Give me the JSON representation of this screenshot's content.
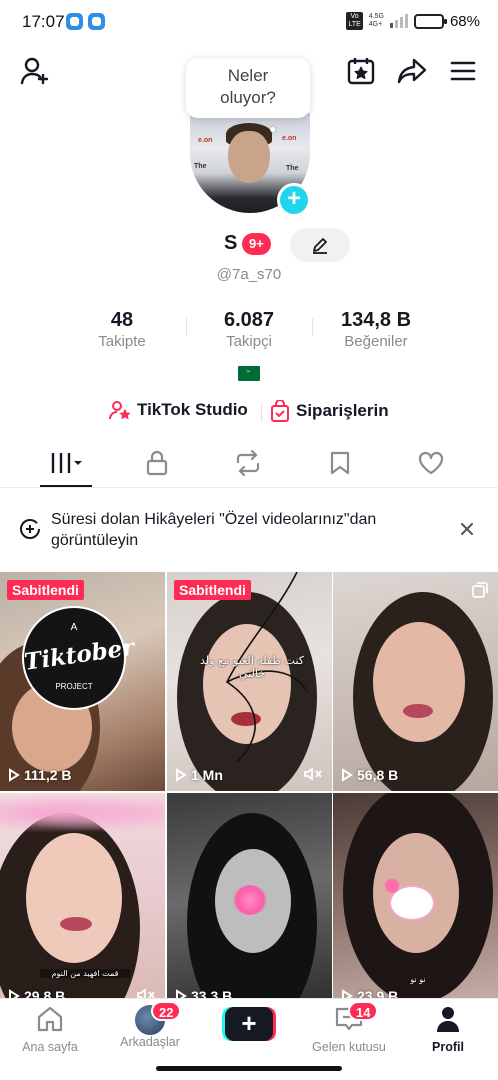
{
  "status_bar": {
    "time": "17:07",
    "volte": "Vo LTE",
    "network": "4.5G 4G+",
    "battery_percent": "68%",
    "battery_level": 0.68
  },
  "header": {
    "bubble_text": "Neler oluyor?"
  },
  "profile": {
    "name": "S",
    "notification_badge": "9+",
    "username": "@7a_s70",
    "flag": "🇸🇦"
  },
  "stats": [
    {
      "value": "48",
      "label": "Takipte"
    },
    {
      "value": "6.087",
      "label": "Takipçi"
    },
    {
      "value": "134,8 B",
      "label": "Beğeniler"
    }
  ],
  "links": {
    "studio": "TikTok Studio",
    "orders": "Siparişlerin"
  },
  "banner": {
    "text": "Süresi dolan Hikâyeleri \"Özel videolarınız\"dan görüntüleyin"
  },
  "videos": [
    {
      "pinned_label": "Sabitlendi",
      "views": "111,2 B",
      "logo_top": "A",
      "logo_main": "Tiktober",
      "logo_bottom": "PROJECT"
    },
    {
      "pinned_label": "Sabitlendi",
      "views": "1 Mn",
      "overlay": "كنت طفله العبو مع ولد خالتي"
    },
    {
      "views": "56,8 B"
    },
    {
      "views": "29,8 B",
      "overlay": "قمت افهيد من النوم"
    },
    {
      "views": "33,3 B"
    },
    {
      "views": "23,9 B",
      "overlay": "نو نو"
    }
  ],
  "bottom_nav": {
    "home": "Ana sayfa",
    "friends": "Arkadaşlar",
    "friends_badge": "22",
    "create": "+",
    "inbox": "Gelen kutusu",
    "inbox_badge": "14",
    "profile": "Profil"
  },
  "colors": {
    "accent": "#fe2c55",
    "cyan": "#25f4ee",
    "text": "#161823",
    "muted": "#8a8b91"
  }
}
